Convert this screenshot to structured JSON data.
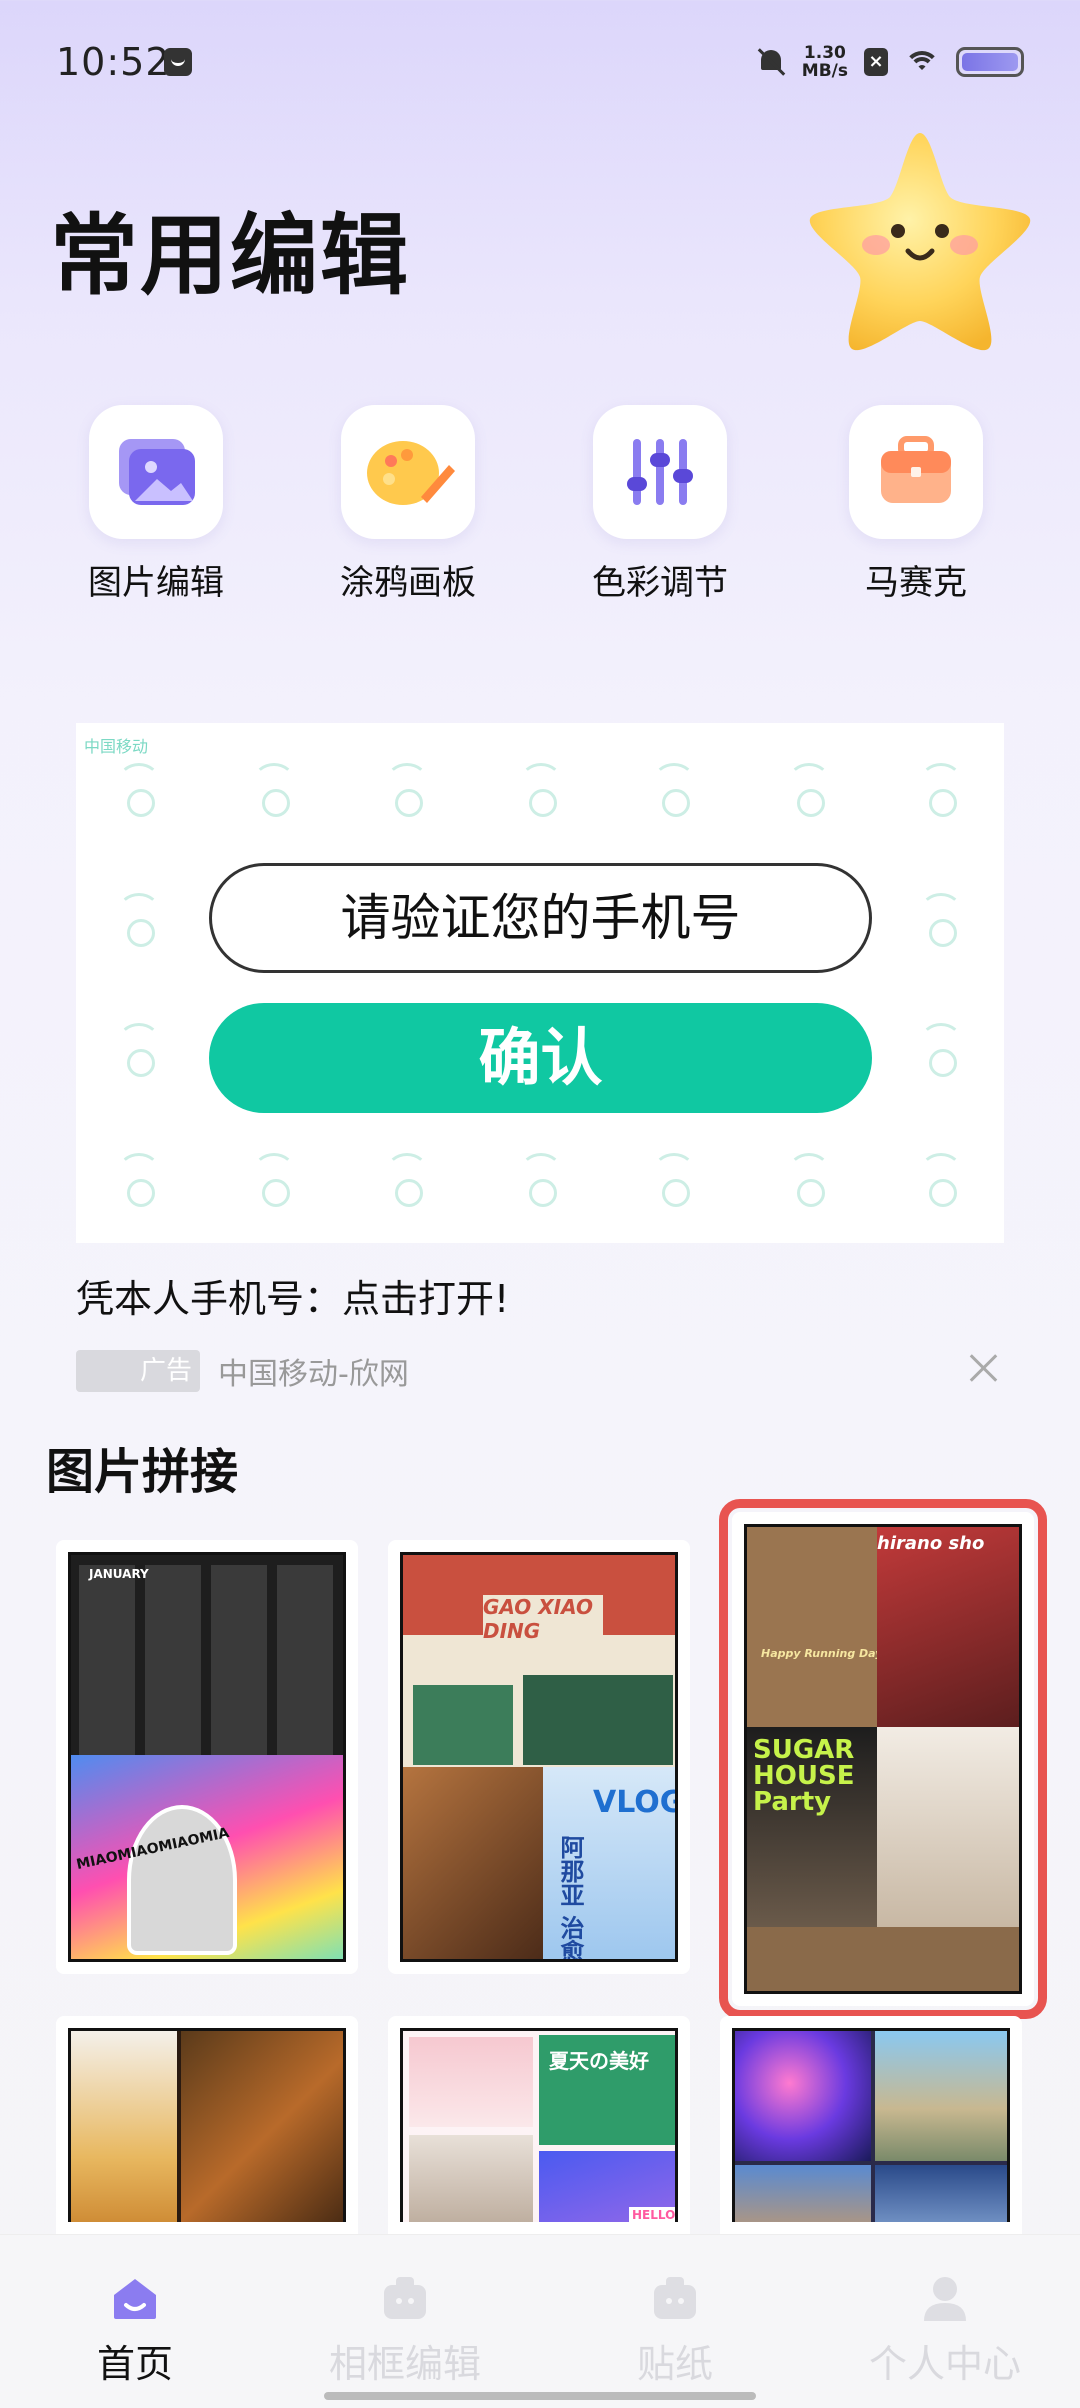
{
  "status_bar": {
    "time": "10:52",
    "speed_value": "1.30",
    "speed_unit": "MB/s"
  },
  "header": {
    "title": "常用编辑"
  },
  "tools": [
    {
      "label": "图片编辑",
      "icon": "photo-edit-icon"
    },
    {
      "label": "涂鸦画板",
      "icon": "palette-icon"
    },
    {
      "label": "色彩调节",
      "icon": "sliders-icon"
    },
    {
      "label": "马赛克",
      "icon": "mosaic-bag-icon"
    }
  ],
  "ad": {
    "logo_text": "中国移动",
    "phone_prompt": "请验证您的手机号",
    "confirm_label": "确认",
    "caption": "凭本人手机号：点击打开!",
    "badge": "广告",
    "source": "中国移动-欣网"
  },
  "collage": {
    "title": "图片拼接",
    "templates": [
      {
        "text_a": "JANUARY",
        "text_b": "MIAOMIAOMIAOMIA"
      },
      {
        "text_a": "GAO XIAO DING",
        "text_b": "VLOG",
        "text_c": "阿那亚 治愈之旅"
      },
      {
        "text_a": "Happy Running Day",
        "text_b": "SUGAR HOUSE Party",
        "text_c": "hirano sho"
      },
      {
        "text_a": "",
        "text_b": ""
      },
      {
        "text_a": "夏天の美好",
        "text_b": "HELLO"
      },
      {
        "text_a": "",
        "text_b": ""
      }
    ]
  },
  "bottom_nav": [
    {
      "label": "首页",
      "icon": "home-icon",
      "active": true
    },
    {
      "label": "相框编辑",
      "icon": "frame-edit-icon",
      "active": false
    },
    {
      "label": "贴纸",
      "icon": "sticker-icon",
      "active": false
    },
    {
      "label": "个人中心",
      "icon": "profile-icon",
      "active": false
    }
  ],
  "colors": {
    "accent": "#8b7cf0",
    "ad_button": "#10c8a2",
    "selection": "#e85450"
  }
}
